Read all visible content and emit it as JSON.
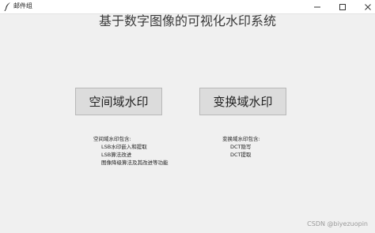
{
  "window": {
    "title": "邮件组",
    "controls": {
      "minimize": "minimize-icon",
      "maximize": "maximize-icon",
      "close": "close-icon"
    }
  },
  "main": {
    "headline": "基于数字图像的可视化水印系统",
    "buttons": {
      "spatial": "空间域水印",
      "transform": "变换域水印"
    },
    "spatial_desc": {
      "heading": "空间域水印包含:",
      "items": [
        "LSB水印嵌入和提取",
        "LSB算法改进",
        "图像降级算法及其改进等功能"
      ]
    },
    "transform_desc": {
      "heading": "变换域水印包含:",
      "items": [
        "DCT隐写",
        "DCT提取"
      ]
    }
  },
  "watermark": "CSDN @biyezuopin",
  "colors": {
    "background": "#f0f0f0",
    "button": "#dcdcdc",
    "button_border": "#b8b8b8"
  }
}
